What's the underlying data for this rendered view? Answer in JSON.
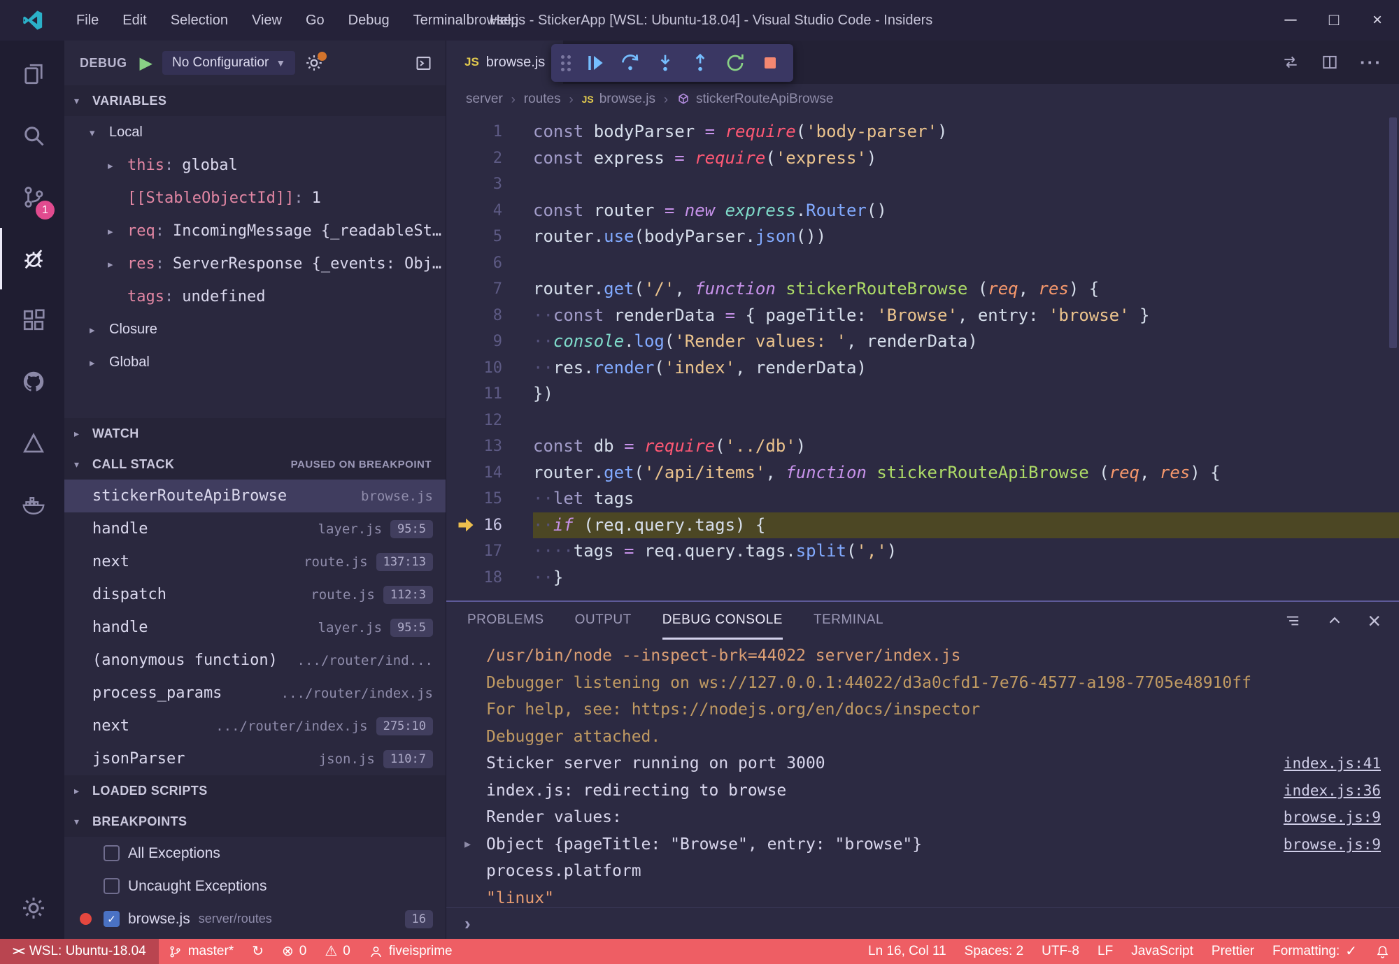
{
  "titlebar": {
    "title": "browse.js - StickerApp [WSL: Ubuntu-18.04] - Visual Studio Code - Insiders",
    "menus": [
      "File",
      "Edit",
      "Selection",
      "View",
      "Go",
      "Debug",
      "Terminal",
      "Help"
    ],
    "controls": {
      "minimize": "─",
      "maximize": "□",
      "close": "×"
    }
  },
  "activity_bar": {
    "items": [
      {
        "name": "explorer"
      },
      {
        "name": "search"
      },
      {
        "name": "source-control",
        "badge": "1"
      },
      {
        "name": "debug",
        "active": true
      },
      {
        "name": "extensions"
      },
      {
        "name": "github"
      },
      {
        "name": "azure"
      },
      {
        "name": "docker"
      }
    ],
    "bottom": [
      {
        "name": "settings"
      }
    ]
  },
  "debug_sidebar": {
    "title": "DEBUG",
    "config": "No Configuratior",
    "variables": {
      "header": "VARIABLES",
      "scopes": [
        {
          "label": "Local",
          "expanded": true,
          "items": [
            {
              "name": "this",
              "value": "global",
              "expandable": true
            },
            {
              "name": "[[StableObjectId]]",
              "value": "1"
            },
            {
              "name": "req",
              "value": "IncomingMessage {_readableSt…",
              "expandable": true
            },
            {
              "name": "res",
              "value": "ServerResponse {_events: Obj…",
              "expandable": true
            },
            {
              "name": "tags",
              "value": "undefined"
            }
          ]
        },
        {
          "label": "Closure",
          "expanded": false
        },
        {
          "label": "Global",
          "expanded": false
        }
      ]
    },
    "watch": {
      "header": "WATCH"
    },
    "call_stack": {
      "header": "CALL STACK",
      "status": "PAUSED ON BREAKPOINT",
      "frames": [
        {
          "name": "stickerRouteApiBrowse",
          "file": "browse.js",
          "loc": "",
          "selected": true
        },
        {
          "name": "handle",
          "file": "layer.js",
          "loc": "95:5"
        },
        {
          "name": "next",
          "file": "route.js",
          "loc": "137:13"
        },
        {
          "name": "dispatch",
          "file": "route.js",
          "loc": "112:3"
        },
        {
          "name": "handle",
          "file": "layer.js",
          "loc": "95:5"
        },
        {
          "name": "(anonymous function)",
          "file": ".../router/ind...",
          "loc": ""
        },
        {
          "name": "process_params",
          "file": ".../router/index.js",
          "loc": ""
        },
        {
          "name": "next",
          "file": ".../router/index.js",
          "loc": "275:10"
        },
        {
          "name": "jsonParser",
          "file": "json.js",
          "loc": "110:7"
        }
      ]
    },
    "loaded_scripts": {
      "header": "LOADED SCRIPTS"
    },
    "breakpoints": {
      "header": "BREAKPOINTS",
      "items": [
        {
          "label": "All Exceptions",
          "checked": false
        },
        {
          "label": "Uncaught Exceptions",
          "checked": false
        },
        {
          "label": "browse.js",
          "detail": "server/routes",
          "badge": "16",
          "checked": true,
          "dot": true
        }
      ]
    }
  },
  "editor": {
    "tab": {
      "label": "browse.js",
      "icon": "JS"
    },
    "breadcrumbs": [
      {
        "label": "server"
      },
      {
        "label": "routes"
      },
      {
        "label": "browse.js",
        "icon": "js"
      },
      {
        "label": "stickerRouteApiBrowse",
        "icon": "method"
      }
    ],
    "debug_toolbar": [
      "continue",
      "step-over",
      "step-into",
      "step-out",
      "restart",
      "stop"
    ],
    "current_line": 16,
    "lines": [
      {
        "n": 1,
        "t": [
          [
            "const ",
            "st"
          ],
          [
            "bodyParser ",
            "id"
          ],
          [
            "= ",
            "op"
          ],
          [
            "require",
            "req"
          ],
          [
            "(",
            "pn"
          ],
          [
            "'body-parser'",
            "str"
          ],
          [
            ")",
            "pn"
          ]
        ]
      },
      {
        "n": 2,
        "t": [
          [
            "const ",
            "st"
          ],
          [
            "express ",
            "id"
          ],
          [
            "= ",
            "op"
          ],
          [
            "require",
            "req"
          ],
          [
            "(",
            "pn"
          ],
          [
            "'express'",
            "str"
          ],
          [
            ")",
            "pn"
          ]
        ]
      },
      {
        "n": 3,
        "t": []
      },
      {
        "n": 4,
        "t": [
          [
            "const ",
            "st"
          ],
          [
            "router ",
            "id"
          ],
          [
            "= ",
            "op"
          ],
          [
            "new ",
            "kw"
          ],
          [
            "express",
            "obj"
          ],
          [
            ".",
            "pn"
          ],
          [
            "Router",
            "fn"
          ],
          [
            "()",
            "pn"
          ]
        ]
      },
      {
        "n": 5,
        "t": [
          [
            "router",
            "id"
          ],
          [
            ".",
            "pn"
          ],
          [
            "use",
            "fn"
          ],
          [
            "(",
            "pn"
          ],
          [
            "bodyParser",
            "id"
          ],
          [
            ".",
            "pn"
          ],
          [
            "json",
            "fn"
          ],
          [
            "())",
            "pn"
          ]
        ]
      },
      {
        "n": 6,
        "t": []
      },
      {
        "n": 7,
        "t": [
          [
            "router",
            "id"
          ],
          [
            ".",
            "pn"
          ],
          [
            "get",
            "fn"
          ],
          [
            "(",
            "pn"
          ],
          [
            "'/'",
            "str"
          ],
          [
            ", ",
            "pn"
          ],
          [
            "function ",
            "kw"
          ],
          [
            "stickerRouteBrowse ",
            "grn"
          ],
          [
            "(",
            "pn"
          ],
          [
            "req",
            "par"
          ],
          [
            ", ",
            "pn"
          ],
          [
            "res",
            "par"
          ],
          [
            ") {",
            "pn"
          ]
        ]
      },
      {
        "n": 8,
        "t": [
          [
            "··",
            "ws"
          ],
          [
            "const ",
            "st"
          ],
          [
            "renderData ",
            "id"
          ],
          [
            "= ",
            "op"
          ],
          [
            "{ ",
            "pn"
          ],
          [
            "pageTitle",
            "id"
          ],
          [
            ": ",
            "pn"
          ],
          [
            "'Browse'",
            "str"
          ],
          [
            ", ",
            "pn"
          ],
          [
            "entry",
            "id"
          ],
          [
            ": ",
            "pn"
          ],
          [
            "'browse'",
            "str"
          ],
          [
            " }",
            "pn"
          ]
        ]
      },
      {
        "n": 9,
        "t": [
          [
            "··",
            "ws"
          ],
          [
            "console",
            "obj"
          ],
          [
            ".",
            "pn"
          ],
          [
            "log",
            "fn"
          ],
          [
            "(",
            "pn"
          ],
          [
            "'Render values: '",
            "str"
          ],
          [
            ", ",
            "pn"
          ],
          [
            "renderData",
            "id"
          ],
          [
            ")",
            "pn"
          ]
        ]
      },
      {
        "n": 10,
        "t": [
          [
            "··",
            "ws"
          ],
          [
            "res",
            "id"
          ],
          [
            ".",
            "pn"
          ],
          [
            "render",
            "fn"
          ],
          [
            "(",
            "pn"
          ],
          [
            "'index'",
            "str"
          ],
          [
            ", ",
            "pn"
          ],
          [
            "renderData",
            "id"
          ],
          [
            ")",
            "pn"
          ]
        ]
      },
      {
        "n": 11,
        "t": [
          [
            "})",
            "pn"
          ]
        ]
      },
      {
        "n": 12,
        "t": []
      },
      {
        "n": 13,
        "t": [
          [
            "const ",
            "st"
          ],
          [
            "db ",
            "id"
          ],
          [
            "= ",
            "op"
          ],
          [
            "require",
            "req"
          ],
          [
            "(",
            "pn"
          ],
          [
            "'../db'",
            "str"
          ],
          [
            ")",
            "pn"
          ]
        ]
      },
      {
        "n": 14,
        "t": [
          [
            "router",
            "id"
          ],
          [
            ".",
            "pn"
          ],
          [
            "get",
            "fn"
          ],
          [
            "(",
            "pn"
          ],
          [
            "'/api/items'",
            "str"
          ],
          [
            ", ",
            "pn"
          ],
          [
            "function ",
            "kw"
          ],
          [
            "stickerRouteApiBrowse ",
            "grn"
          ],
          [
            "(",
            "pn"
          ],
          [
            "req",
            "par"
          ],
          [
            ", ",
            "pn"
          ],
          [
            "res",
            "par"
          ],
          [
            ") {",
            "pn"
          ]
        ]
      },
      {
        "n": 15,
        "t": [
          [
            "··",
            "ws"
          ],
          [
            "let ",
            "st"
          ],
          [
            "tags",
            "id"
          ]
        ]
      },
      {
        "n": 16,
        "t": [
          [
            "··",
            "ws"
          ],
          [
            "if ",
            "kw"
          ],
          [
            "(",
            "pn"
          ],
          [
            "req",
            "id"
          ],
          [
            ".",
            "pn"
          ],
          [
            "query",
            "id"
          ],
          [
            ".",
            "pn"
          ],
          [
            "tags",
            "id"
          ],
          [
            ") {",
            "pn"
          ]
        ]
      },
      {
        "n": 17,
        "t": [
          [
            "····",
            "ws"
          ],
          [
            "tags ",
            "id"
          ],
          [
            "= ",
            "op"
          ],
          [
            "req",
            "id"
          ],
          [
            ".",
            "pn"
          ],
          [
            "query",
            "id"
          ],
          [
            ".",
            "pn"
          ],
          [
            "tags",
            "id"
          ],
          [
            ".",
            "pn"
          ],
          [
            "split",
            "fn"
          ],
          [
            "(",
            "pn"
          ],
          [
            "','",
            "str"
          ],
          [
            ")",
            "pn"
          ]
        ]
      },
      {
        "n": 18,
        "t": [
          [
            "··",
            "ws"
          ],
          [
            "}",
            "pn"
          ]
        ]
      }
    ]
  },
  "panel": {
    "tabs": [
      "PROBLEMS",
      "OUTPUT",
      "DEBUG CONSOLE",
      "TERMINAL"
    ],
    "active_tab": "DEBUG CONSOLE",
    "console": [
      {
        "text": "/usr/bin/node --inspect-brk=44022 server/index.js",
        "cls": "cmd"
      },
      {
        "text": "Debugger listening on ws://127.0.0.1:44022/d3a0cfd1-7e76-4577-a198-7705e48910ff",
        "cls": "info"
      },
      {
        "text": "For help, see: https://nodejs.org/en/docs/inspector",
        "cls": "info"
      },
      {
        "text": "Debugger attached.",
        "cls": "info"
      },
      {
        "text": "Sticker server running on port 3000",
        "cls": "fg",
        "link": "index.js:41"
      },
      {
        "text": "index.js: redirecting to browse",
        "cls": "fg",
        "link": "index.js:36"
      },
      {
        "text": "Render values: ",
        "cls": "fg",
        "link": "browse.js:9"
      },
      {
        "text": "Object {pageTitle: \"Browse\", entry: \"browse\"}",
        "cls": "fg",
        "link": "browse.js:9",
        "chevron": true
      },
      {
        "text": "process.platform",
        "cls": "fg"
      },
      {
        "text": "\"linux\"",
        "cls": "str"
      }
    ]
  },
  "status_bar": {
    "left": [
      {
        "name": "remote",
        "label": "WSL: Ubuntu-18.04"
      },
      {
        "name": "branch",
        "label": "master*"
      },
      {
        "name": "sync",
        "label": ""
      },
      {
        "name": "errors",
        "label": "0"
      },
      {
        "name": "warnings",
        "label": "0"
      },
      {
        "name": "account",
        "label": "fiveisprime"
      }
    ],
    "right": [
      {
        "name": "cursor-position",
        "label": "Ln 16, Col 11"
      },
      {
        "name": "indentation",
        "label": "Spaces: 2"
      },
      {
        "name": "encoding",
        "label": "UTF-8"
      },
      {
        "name": "eol",
        "label": "LF"
      },
      {
        "name": "language-mode",
        "label": "JavaScript"
      },
      {
        "name": "prettier",
        "label": "Prettier"
      },
      {
        "name": "formatting",
        "label": "Formatting:",
        "check": true
      },
      {
        "name": "notifications",
        "label": ""
      }
    ]
  }
}
